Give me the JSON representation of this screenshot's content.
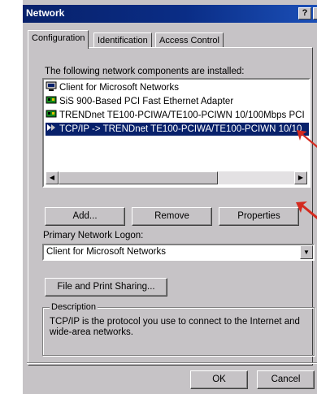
{
  "window": {
    "title": "Network",
    "help_button": "?",
    "close_button": "×"
  },
  "tabs": [
    {
      "label": "Configuration",
      "active": true
    },
    {
      "label": "Identification",
      "active": false
    },
    {
      "label": "Access Control",
      "active": false
    }
  ],
  "components": {
    "intro_label": "The following network components are installed:",
    "items": [
      {
        "label": "Client for Microsoft Networks",
        "icon": "client-icon",
        "selected": false
      },
      {
        "label": "SiS 900-Based PCI Fast Ethernet Adapter",
        "icon": "adapter-icon",
        "selected": false
      },
      {
        "label": "TRENDnet TE100-PCIWA/TE100-PCIWN 10/100Mbps PCI",
        "icon": "adapter-icon",
        "selected": false
      },
      {
        "label": "TCP/IP -> TRENDnet TE100-PCIWA/TE100-PCIWN 10/10",
        "icon": "protocol-icon",
        "selected": true
      }
    ]
  },
  "buttons": {
    "add": "Add...",
    "remove": "Remove",
    "properties": "Properties",
    "file_print_sharing": "File and Print Sharing...",
    "ok": "OK",
    "cancel": "Cancel"
  },
  "logon": {
    "label": "Primary Network Logon:",
    "value": "Client for Microsoft Networks"
  },
  "description": {
    "legend": "Description",
    "text": "TCP/IP is the protocol you use to connect to the Internet and wide-area networks."
  },
  "colors": {
    "titlebar": "#08216b",
    "selection": "#08216b",
    "arrow": "#d42a1f"
  }
}
